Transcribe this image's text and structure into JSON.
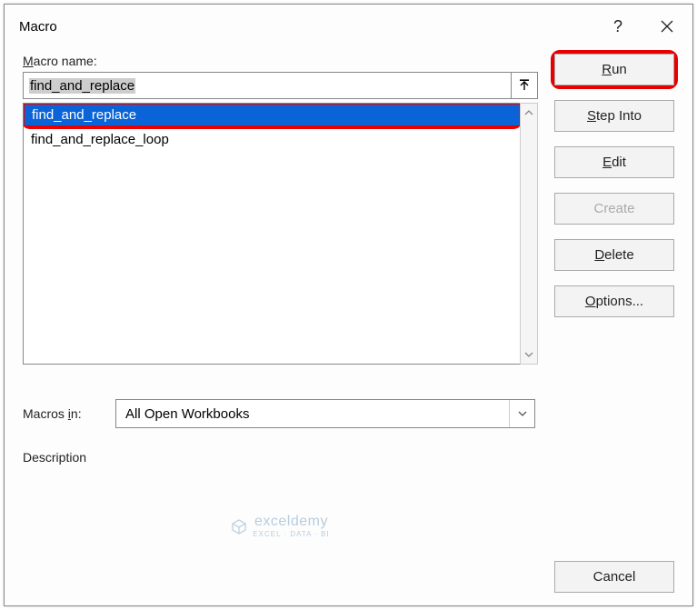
{
  "dialog": {
    "title": "Macro",
    "help_symbol": "?"
  },
  "name_label": {
    "pre": "",
    "u": "M",
    "post": "acro name:"
  },
  "name_input": "find_and_replace",
  "macro_list": [
    {
      "label": "find_and_replace",
      "selected": true
    },
    {
      "label": "find_and_replace_loop",
      "selected": false
    }
  ],
  "macrosin_label": {
    "pre": "Macros ",
    "u": "i",
    "post": "n:"
  },
  "macrosin_value": "All Open Workbooks",
  "description_label": "Description",
  "watermark": {
    "text": "exceldemy",
    "sub": "EXCEL · DATA · BI"
  },
  "buttons": {
    "run": {
      "u": "R",
      "post": "un"
    },
    "stepinto": {
      "u": "S",
      "post": "tep Into"
    },
    "edit": {
      "u": "E",
      "post": "dit"
    },
    "create": {
      "post": "Create"
    },
    "delete": {
      "u": "D",
      "post": "elete"
    },
    "options": {
      "u": "O",
      "post": "ptions..."
    },
    "cancel": "Cancel"
  }
}
